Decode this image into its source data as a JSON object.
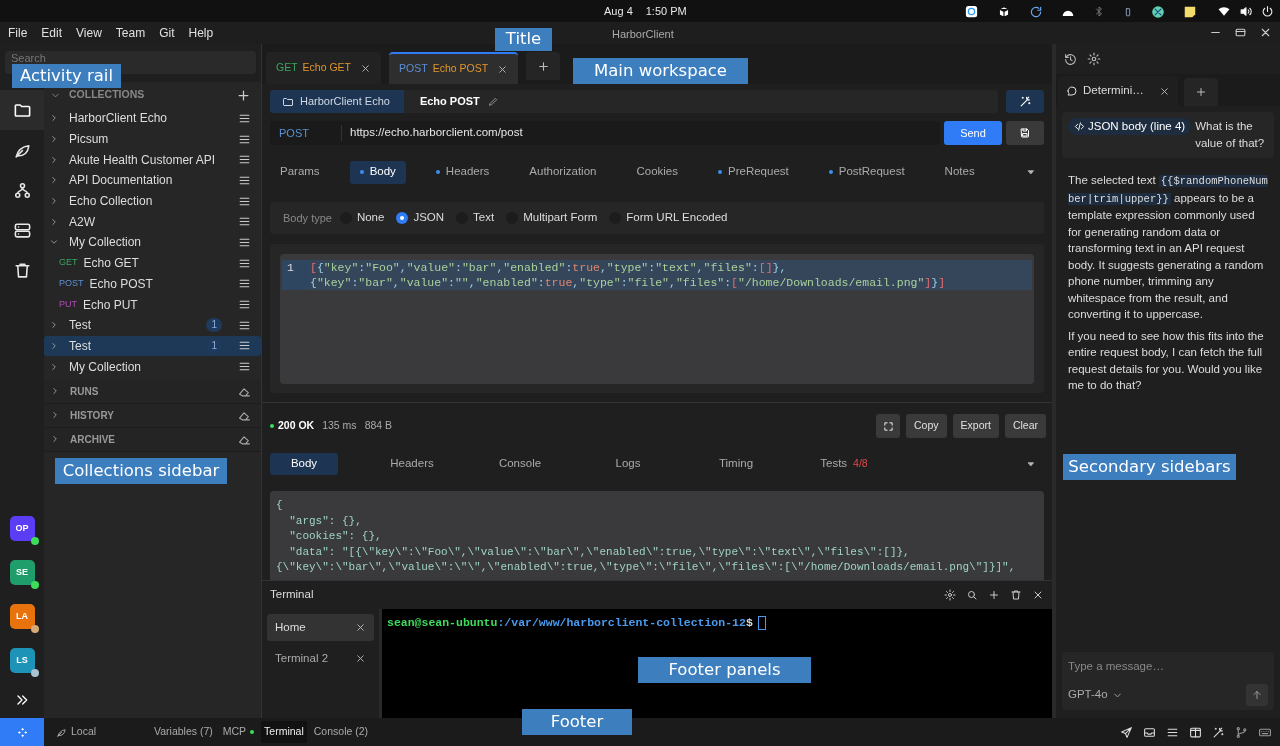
{
  "os_bar": {
    "date": "Aug 4",
    "time": "1:50 PM"
  },
  "menu": [
    "File",
    "Edit",
    "View",
    "Team",
    "Git",
    "Help"
  ],
  "window": {
    "title": "HarborClient"
  },
  "search": {
    "placeholder": "Search"
  },
  "activity_rail": [
    {
      "kind": "folder",
      "selected": true
    },
    {
      "kind": "leaf",
      "selected": false
    },
    {
      "kind": "flow",
      "selected": false
    },
    {
      "kind": "server",
      "selected": false
    },
    {
      "kind": "trash",
      "selected": false
    }
  ],
  "avatars": [
    {
      "initials": "OP",
      "color": "#5b3df5",
      "status": {
        "color": "#3ddc5a"
      }
    },
    {
      "initials": "SE",
      "color": "#1f9d6b",
      "status": {
        "color": "#3ddc5a"
      }
    },
    {
      "initials": "LA",
      "color": "#e8730c",
      "status": {
        "color": "#d9a877"
      }
    },
    {
      "initials": "LS",
      "color": "#1e93b8",
      "status": {
        "color": "#a9c2d0"
      }
    }
  ],
  "collections": {
    "title": "COLLECTIONS",
    "items": [
      {
        "name": "HarborClient Echo",
        "expanded": false,
        "selected": false
      },
      {
        "name": "Picsum",
        "expanded": false,
        "selected": false
      },
      {
        "name": "Akute Health Customer API",
        "expanded": false,
        "selected": false
      },
      {
        "name": "API Documentation",
        "expanded": false,
        "selected": false
      },
      {
        "name": "Echo Collection",
        "expanded": false,
        "selected": false
      },
      {
        "name": "A2W",
        "expanded": false,
        "selected": false
      },
      {
        "name": "My Collection",
        "expanded": true,
        "selected": false,
        "children": [
          {
            "method": "GET",
            "name": "Echo GET"
          },
          {
            "method": "POST",
            "name": "Echo POST"
          },
          {
            "method": "PUT",
            "name": "Echo PUT"
          }
        ]
      },
      {
        "name": "Test",
        "expanded": false,
        "selected": false,
        "badge": "1"
      },
      {
        "name": "Test",
        "expanded": false,
        "selected": true,
        "badge": "1"
      },
      {
        "name": "My Collection",
        "expanded": false,
        "selected": false
      }
    ]
  },
  "sections": [
    {
      "label": "RUNS"
    },
    {
      "label": "HISTORY"
    },
    {
      "label": "ARCHIVE"
    }
  ],
  "tabs": [
    {
      "method": "GET",
      "name": "Echo GET",
      "selected": false
    },
    {
      "method": "POST",
      "name": "Echo POST",
      "selected": true
    }
  ],
  "request": {
    "breadcrumb": "HarborClient Echo",
    "name": "Echo POST",
    "method": "POST",
    "url": "https://echo.harborclient.com/post",
    "send": "Send"
  },
  "request_tabs": [
    {
      "label": "Params",
      "dot": false,
      "selected": false
    },
    {
      "label": "Body",
      "dot": true,
      "selected": true
    },
    {
      "label": "Headers",
      "dot": true,
      "selected": false
    },
    {
      "label": "Authorization",
      "dot": false,
      "selected": false
    },
    {
      "label": "Cookies",
      "dot": false,
      "selected": false
    },
    {
      "label": "PreRequest",
      "dot": true,
      "selected": false
    },
    {
      "label": "PostRequest",
      "dot": true,
      "selected": false
    },
    {
      "label": "Notes",
      "dot": false,
      "selected": false
    }
  ],
  "body_type": {
    "label": "Body type",
    "options": [
      {
        "label": "None",
        "selected": false
      },
      {
        "label": "JSON",
        "selected": true
      },
      {
        "label": "Text",
        "selected": false
      },
      {
        "label": "Multipart Form",
        "selected": false
      },
      {
        "label": "Form URL Encoded",
        "selected": false
      }
    ]
  },
  "editor": {
    "line_number": "1",
    "lines": [
      "[{\"key\":\"Foo\",\"value\":\"bar\",\"enabled\":true,\"type\":\"text\",\"files\":[]},",
      "{\"key\":\"bar\",\"value\":\"\",\"enabled\":true,\"type\":\"file\",\"files\":[\"/home/Downloads/email.png\"]}]"
    ]
  },
  "response": {
    "status": "200 OK",
    "time": "135 ms",
    "size": "884 B",
    "buttons": [
      "Copy",
      "Export",
      "Clear"
    ],
    "tabs": [
      {
        "label": "Body",
        "selected": true
      },
      {
        "label": "Headers",
        "selected": false
      },
      {
        "label": "Console",
        "selected": false
      },
      {
        "label": "Logs",
        "selected": false
      },
      {
        "label": "Timing",
        "selected": false
      },
      {
        "label": "Tests",
        "count": "4/8",
        "selected": false
      }
    ],
    "body": [
      "{",
      "  \"args\": {},",
      "  \"cookies\": {},",
      "  \"data\": \"[{\\\"key\\\":\\\"Foo\\\",\\\"value\\\":\\\"bar\\\",\\\"enabled\\\":true,\\\"type\\\":\\\"text\\\",\\\"files\\\":[]},",
      "{\\\"key\\\":\\\"bar\\\",\\\"value\\\":\\\"\\\",\\\"enabled\\\":true,\\\"type\\\":\\\"file\\\",\\\"files\\\":[\\\"/home/Downloads/email.png\\\"]}]\","
    ]
  },
  "terminal": {
    "title": "Terminal",
    "sessions": [
      {
        "label": "Home",
        "selected": true
      },
      {
        "label": "Terminal 2",
        "selected": false
      }
    ],
    "prompt_user": "sean@sean-ubuntu",
    "prompt_path": ":/var/www/harborclient-collection-12",
    "prompt_symbol": "$"
  },
  "chat": {
    "tabs": [
      {
        "label": "Determini…",
        "selected": true
      }
    ],
    "context_chip": "JSON body (line 4)",
    "question": "What is the value of that?",
    "answer": [
      {
        "before": "The selected text",
        "code": "{{$randomPhoneNumber|trim|upper}}",
        "after": "appears to be a template expression commonly used for generating random data or transforming text in an API request body. It suggests generating a random phone number, trimming any whitespace from the result, and converting it to uppercase."
      },
      {
        "before": "If you need to see how this fits into the entire request body, I can fetch the full request details for you. Would you like me to do that?"
      }
    ],
    "input_placeholder": "Type a message…",
    "model": "GPT-4o"
  },
  "footer": {
    "environment": "Local",
    "items": [
      {
        "label": "Variables (7)",
        "selected": false,
        "connected": false
      },
      {
        "label": "MCP",
        "selected": false,
        "connected": true
      },
      {
        "label": "Terminal",
        "selected": true,
        "connected": false
      },
      {
        "label": "Console (2)",
        "selected": false,
        "connected": false
      }
    ]
  },
  "annotations": [
    "Title",
    "Activity rail",
    "Main workspace",
    "Collections sidebar",
    "Footer panels",
    "Footer",
    "Secondary sidebars"
  ]
}
